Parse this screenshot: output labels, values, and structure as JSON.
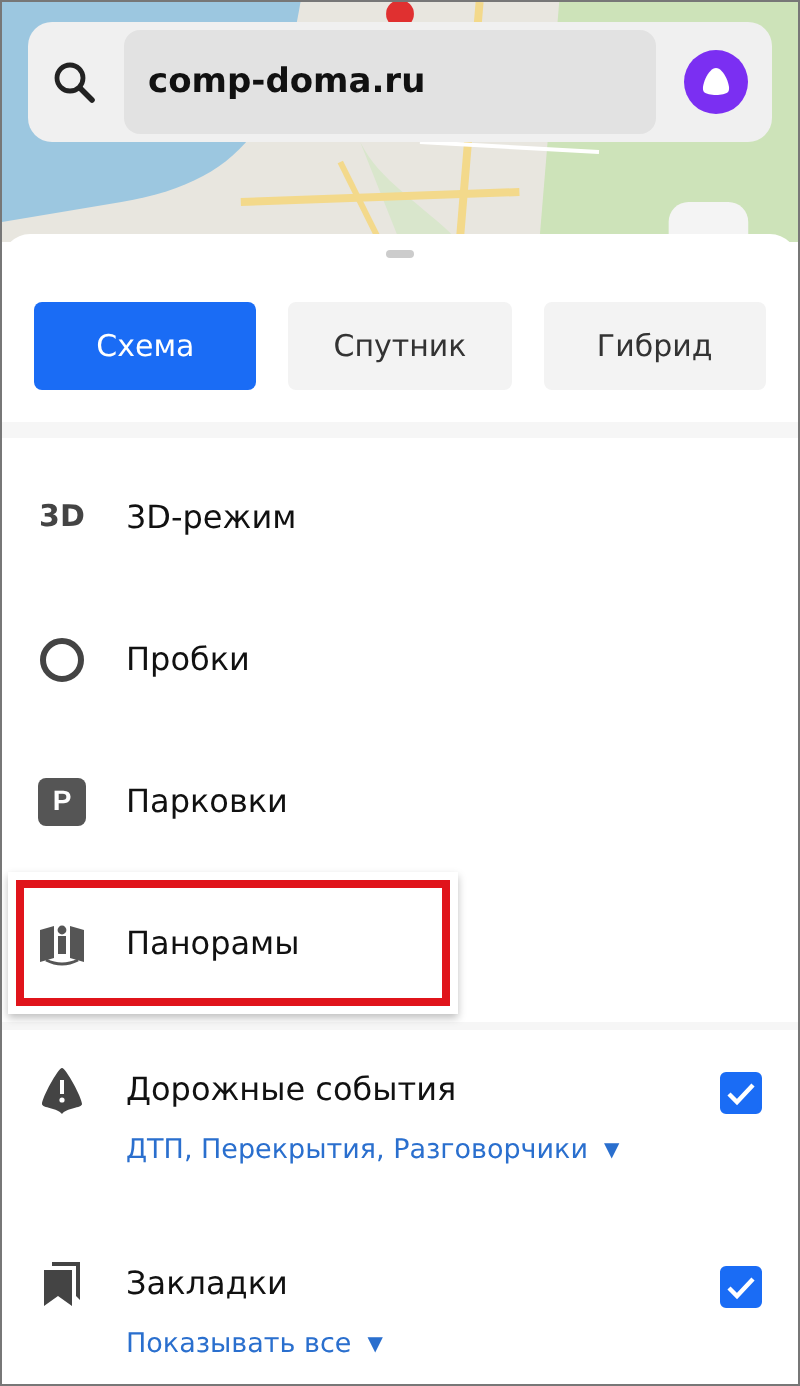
{
  "search": {
    "value": "comp-doma.ru"
  },
  "map_tabs": [
    {
      "label": "Схема",
      "selected": true
    },
    {
      "label": "Спутник",
      "selected": false
    },
    {
      "label": "Гибрид",
      "selected": false
    }
  ],
  "layers": [
    {
      "kind": "plain",
      "icon_text": "3D",
      "label": "3D-режим",
      "highlighted": false
    },
    {
      "kind": "plain",
      "label": "Пробки",
      "highlighted": false
    },
    {
      "kind": "plain",
      "icon_text": "P",
      "label": "Парковки",
      "highlighted": false
    },
    {
      "kind": "plain",
      "label": "Панорамы",
      "highlighted": true
    }
  ],
  "options": [
    {
      "kind": "checkbox",
      "label": "Дорожные события",
      "checked": true,
      "filter": "ДТП, Перекрытия, Разговорчики",
      "caret": "▼"
    },
    {
      "kind": "checkbox",
      "label": "Закладки",
      "checked": true,
      "filter": "Показывать все",
      "caret": "▼"
    }
  ]
}
